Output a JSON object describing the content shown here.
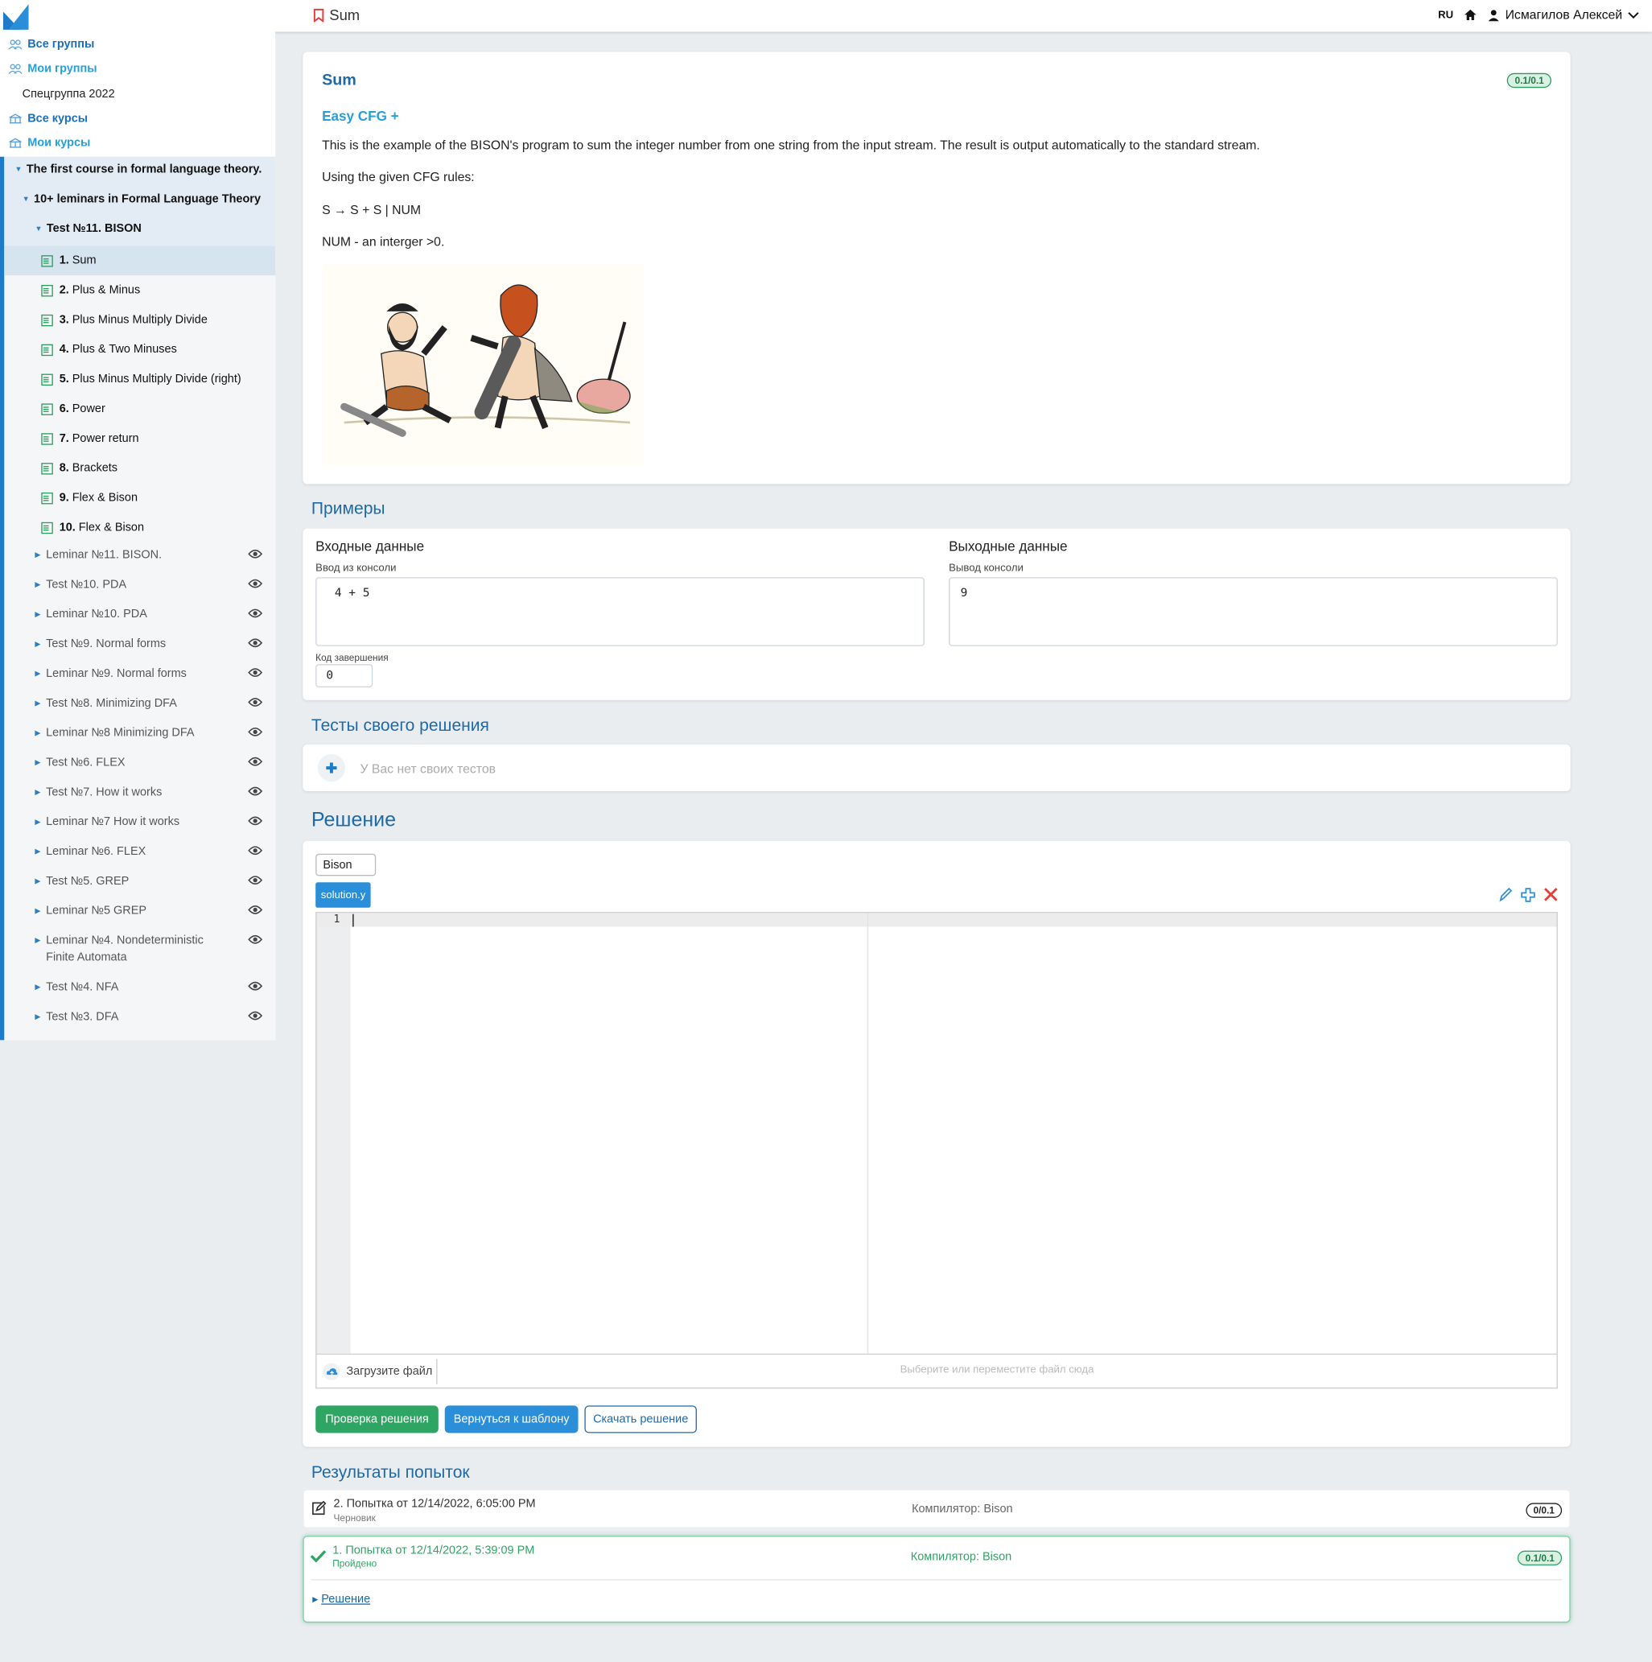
{
  "topbar": {
    "title": "Sum",
    "lang": "RU",
    "user": "Исмагилов Алексей"
  },
  "sidebar": {
    "links": [
      "Все группы",
      "Мои группы",
      "Спецгруппа 2022",
      "Все курсы",
      "Мои курсы"
    ],
    "course": "The first course in formal language theory.",
    "module": "10+ leminars in Formal Language Theory",
    "test": "Test №11. BISON",
    "items": [
      {
        "num": "1.",
        "label": "Sum"
      },
      {
        "num": "2.",
        "label": "Plus & Minus"
      },
      {
        "num": "3.",
        "label": "Plus Minus Multiply Divide"
      },
      {
        "num": "4.",
        "label": "Plus & Two Minuses"
      },
      {
        "num": "5.",
        "label": "Plus Minus Multiply Divide (right)"
      },
      {
        "num": "6.",
        "label": "Power"
      },
      {
        "num": "7.",
        "label": "Power return"
      },
      {
        "num": "8.",
        "label": "Brackets"
      },
      {
        "num": "9.",
        "label": "Flex & Bison"
      },
      {
        "num": "10.",
        "label": "Flex & Bison"
      }
    ],
    "collapsed": [
      "Leminar №11. BISON.",
      "Test №10. PDA",
      "Leminar №10. PDA",
      "Test №9. Normal forms",
      "Leminar №9. Normal forms",
      "Test №8. Minimizing DFA",
      "Leminar №8 Minimizing DFA",
      "Test №6. FLEX",
      "Test №7. How it works",
      "Leminar №7 How it works",
      "Leminar №6. FLEX",
      "Test №5. GREP",
      "Leminar №5 GREP",
      "Leminar №4. Nondeterministic Finite Automata",
      "Test №4. NFA",
      "Test №3. DFA"
    ]
  },
  "task": {
    "title": "Sum",
    "score": "0.1/0.1",
    "subtitle": "Easy CFG +",
    "p1": "This is the example of the BISON's program to sum the integer number from one string from the input stream. The result is output automatically to the standard stream.",
    "p2": "Using the given CFG rules:",
    "p3": "S → S + S | NUM",
    "p4": "NUM - an interger >0."
  },
  "examples": {
    "title": "Примеры",
    "input_head": "Входные данные",
    "input_label": "Ввод из консоли",
    "input_value": "4 + 5",
    "output_head": "Выходные данные",
    "output_label": "Вывод консоли",
    "output_value": "9",
    "exit_label": "Код завершения",
    "exit_value": "0"
  },
  "own_tests": {
    "title": "Тесты своего решения",
    "empty": "У Вас нет своих тестов"
  },
  "solution": {
    "title": "Решение",
    "compiler": "Bison",
    "file_tab": "solution.y",
    "line_number": "1",
    "upload_label": "Загрузите файл",
    "drop_hint": "Выберите или переместите файл сюда",
    "check_btn": "Проверка решения",
    "reset_btn": "Вернуться к шаблону",
    "download_btn": "Скачать решение"
  },
  "attempts": {
    "title": "Результаты попыток",
    "list": [
      {
        "title": "2. Попытка от 12/14/2022, 6:05:00 PM",
        "status": "Черновик",
        "compiler": "Компилятор: Bison",
        "score": "0/0.1"
      },
      {
        "title": "1. Попытка от 12/14/2022, 5:39:09 PM",
        "status": "Пройдено",
        "compiler": "Компилятор: Bison",
        "score": "0.1/0.1",
        "solution_link": "Решение"
      }
    ]
  },
  "colors": {
    "accent": "#1d7bc9",
    "success": "#2a9d5c",
    "title": "#1d6aa8"
  }
}
